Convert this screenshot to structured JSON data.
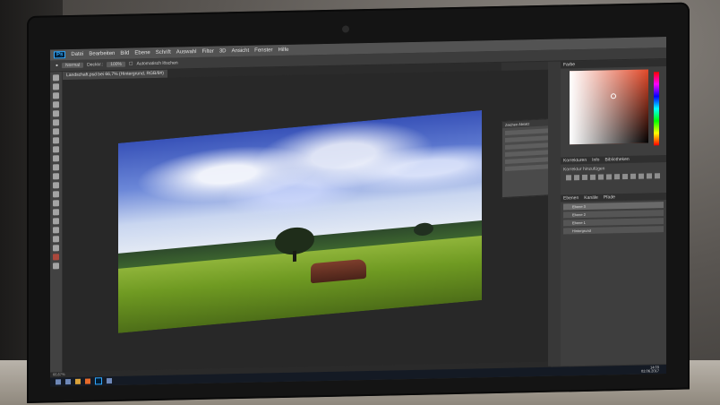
{
  "menubar": {
    "logo": "Ps",
    "items": [
      "Datei",
      "Bearbeiten",
      "Bild",
      "Ebene",
      "Schrift",
      "Auswahl",
      "Filter",
      "3D",
      "Ansicht",
      "Fenster",
      "Hilfe"
    ]
  },
  "options": {
    "mode_value": "Normal",
    "opacity_value": "100%",
    "flow_label": "Deckkr.:",
    "auto_label": "Automatisch löschen"
  },
  "document": {
    "tab_label": "Landschaft.psd bei 66,7% (Hintergrund, RGB/8#)"
  },
  "status": {
    "zoom": "66,67%"
  },
  "panels": {
    "color_tab": "Farbe",
    "adjustments_tabs": [
      "Korrekturen",
      "Info",
      "Bibliotheken"
    ],
    "adjustments_label": "Korrektur hinzufügen",
    "layers_tabs": [
      "Ebenen",
      "Kanäle",
      "Pfade"
    ],
    "layers": [
      "Ebene 3",
      "Ebene 2",
      "Ebene 1",
      "Hintergrund"
    ],
    "character_tabs": [
      "Zeichen",
      "Absatz"
    ]
  },
  "taskbar": {
    "time": "14:03",
    "date": "02.06.2017"
  },
  "colors": {
    "accent": "#31a8ff",
    "foreground": "#c64a3b",
    "panel_bg": "#3e3e3e"
  }
}
